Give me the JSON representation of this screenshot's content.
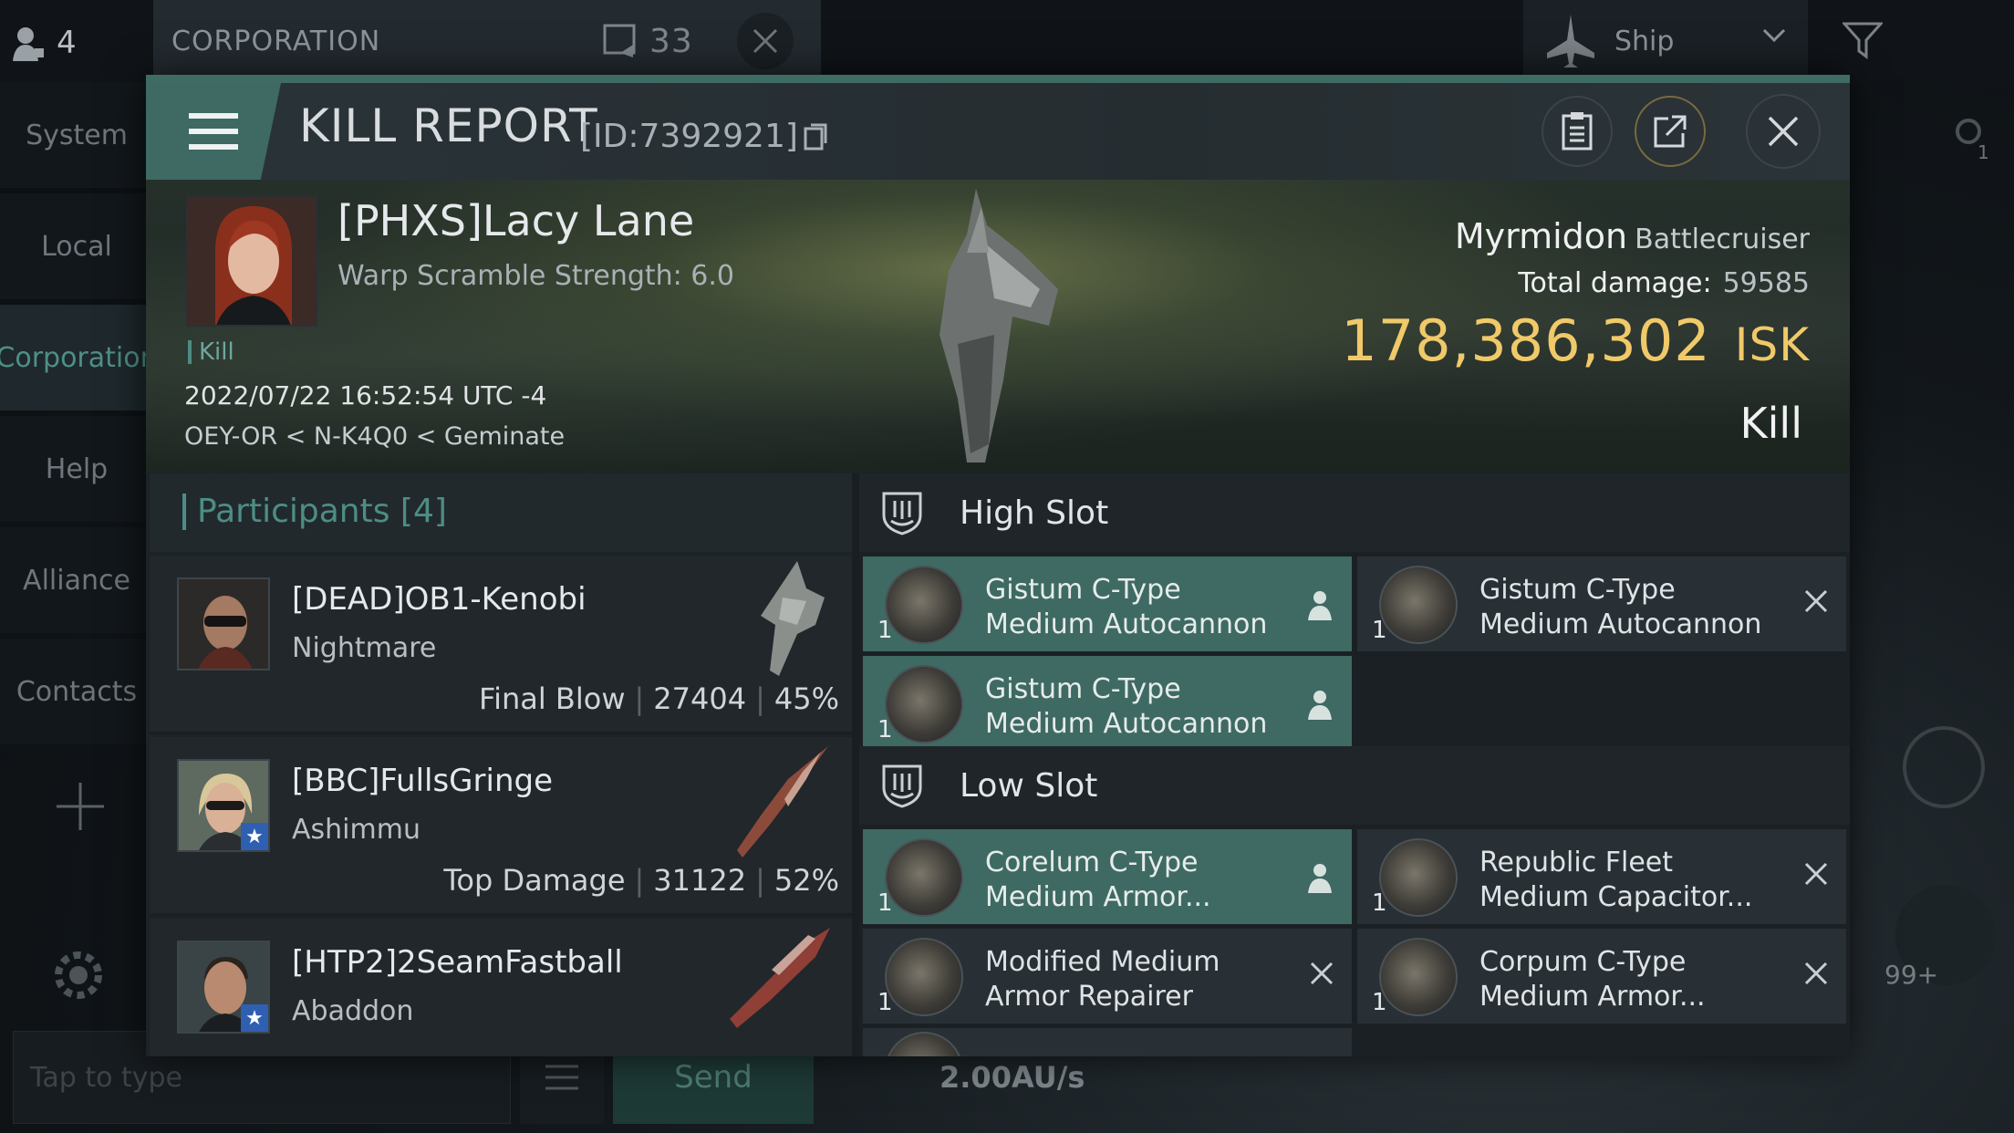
{
  "background": {
    "online_count": "4",
    "corp_tab_title": "CORPORATION",
    "corp_member_count": "33",
    "ship_filter_label": "Ship",
    "side_nav": [
      "System",
      "Local",
      "Corporation",
      "Help",
      "Alliance",
      "Contacts"
    ],
    "chat_placeholder": "Tap to type",
    "send_label": "Send",
    "speed": "2.00AU/s",
    "notif_badge": "99+",
    "search_count": "1"
  },
  "report": {
    "title": "KILL REPORT",
    "id_text": "[ID:7392921]",
    "victim": {
      "name": "[PHXS]Lacy Lane",
      "warp_scramble": "Warp Scramble Strength: 6.0",
      "kill_tag": "Kill",
      "datetime": "2022/07/22 16:52:54 UTC -4",
      "location": "OEY-OR < N-K4Q0 < Geminate",
      "ship_name": "Myrmidon",
      "ship_class": "Battlecruiser",
      "total_damage_label": "Total damage:",
      "total_damage": "59585",
      "isk_value": "178,386,302",
      "isk_unit": "ISK",
      "result": "Kill"
    },
    "participants": {
      "title": "Participants [4]",
      "rows": [
        {
          "name": "[DEAD]OB1-Kenobi",
          "ship": "Nightmare",
          "role": "Final Blow",
          "damage": "27404",
          "percent": "45%"
        },
        {
          "name": "[BBC]FullsGringe",
          "ship": "Ashimmu",
          "role": "Top Damage",
          "damage": "31122",
          "percent": "52%"
        },
        {
          "name": "[HTP2]2SeamFastball",
          "ship": "Abaddon",
          "role": "",
          "damage": "",
          "percent": ""
        }
      ]
    },
    "high_slot": {
      "title": "High Slot",
      "items": [
        {
          "qty": "1",
          "line1": "Gistum C-Type",
          "line2": "Medium Autocannon",
          "status": "dropped"
        },
        {
          "qty": "1",
          "line1": "Gistum C-Type",
          "line2": "Medium Autocannon",
          "status": "destroyed"
        },
        {
          "qty": "1",
          "line1": "Gistum C-Type",
          "line2": "Medium Autocannon",
          "status": "dropped"
        }
      ]
    },
    "low_slot": {
      "title": "Low Slot",
      "items": [
        {
          "qty": "1",
          "line1": "Corelum C-Type",
          "line2": "Medium Armor...",
          "status": "dropped"
        },
        {
          "qty": "1",
          "line1": "Republic Fleet",
          "line2": "Medium Capacitor...",
          "status": "destroyed"
        },
        {
          "qty": "1",
          "line1": "Modified Medium",
          "line2": "Armor Repairer",
          "status": "destroyed"
        },
        {
          "qty": "1",
          "line1": "Corpum C-Type",
          "line2": "Medium Armor...",
          "status": "destroyed"
        }
      ]
    },
    "colors": {
      "accent_teal": "#3e6a63",
      "isk_gold": "#f0c969",
      "panel": "#191e22"
    }
  }
}
